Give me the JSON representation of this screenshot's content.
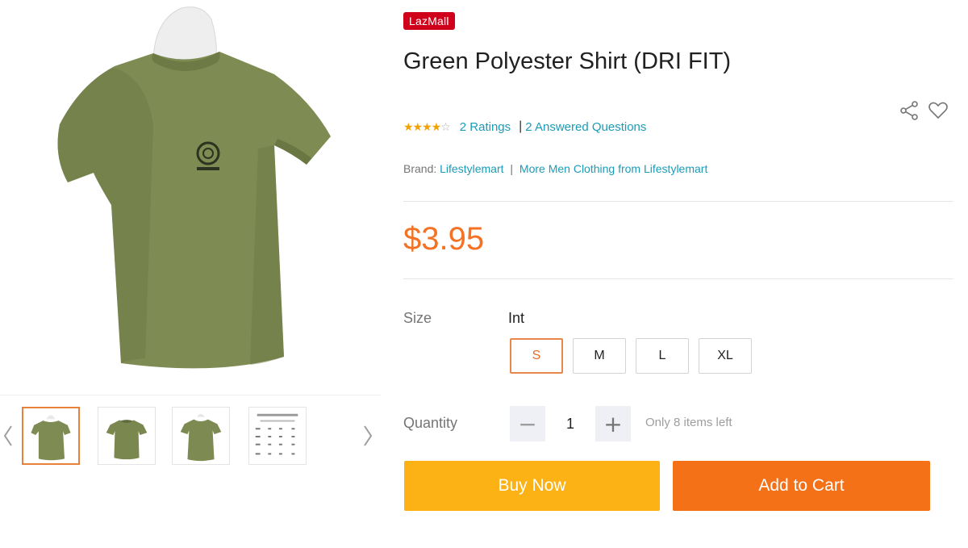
{
  "badge": {
    "label": "LazMall"
  },
  "product": {
    "title": "Green Polyester Shirt (DRI FIT)",
    "price": "$3.95",
    "image_icon": "tshirt-image",
    "shirt_color": "#7e8b52"
  },
  "rating": {
    "stars_filled": "★★★★",
    "stars_empty": "☆",
    "ratings_text": "2 Ratings",
    "separator": "|",
    "questions_text": "2 Answered Questions"
  },
  "brand": {
    "label": "Brand:",
    "name": "Lifestylemart",
    "separator": "|",
    "more_text": "More Men Clothing from Lifestylemart"
  },
  "actions": {
    "share_icon": "share-icon",
    "wishlist_icon": "heart-icon"
  },
  "size": {
    "label": "Size",
    "type": "Int",
    "options": [
      "S",
      "M",
      "L",
      "XL"
    ],
    "selected": "S"
  },
  "quantity": {
    "label": "Quantity",
    "minus": "−",
    "value": "1",
    "plus": "+",
    "stock_note": "Only 8 items left"
  },
  "buttons": {
    "buy_now": "Buy Now",
    "add_to_cart": "Add to Cart"
  },
  "colors": {
    "accent_orange": "#f57224",
    "buy_yellow": "#fcb114",
    "cart_orange": "#f57118",
    "link_blue": "#1a9cb7",
    "lazmall_red": "#d0011b"
  }
}
